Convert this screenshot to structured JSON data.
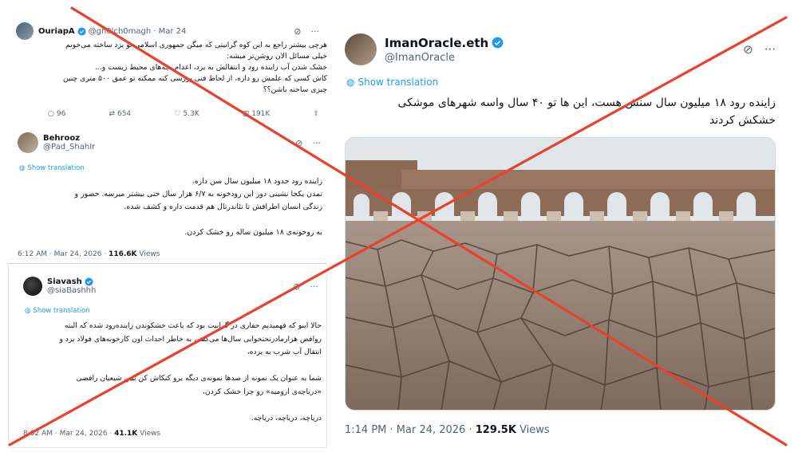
{
  "colors": {
    "accent": "#1d9bf0",
    "cross": "#e8412c",
    "text": "#0f1419",
    "muted": "#536471"
  },
  "tweet1": {
    "name": "OuriapA",
    "handle": "@gh0lch0magh",
    "date": "· Mar 24",
    "body": "هرچی بیشتر راجع به این کوه گرانیتی که میگن جمهوری اسلامی تو یزد ساخته می‌خونم\nخیلی مسائل الان روشن‌تر میشه:\nخشک شدن آب زاینده رود و انتقالش به یزد، اعدام بچه‌های محیط زیست و...\nکاش کسی که علمش رو داره، از لحاظ فنی بررسی کنه ممکنه تو عمق ۵۰۰ متری چنین\nچیزی ساخته باشن؟؟",
    "replies": "96",
    "reposts": "654",
    "likes": "5.3K",
    "views": "191K"
  },
  "tweet2": {
    "name": "Behrooz",
    "handle": "@Pad_ShahIr",
    "show_translation": "Show translation",
    "body": "زاینده رود حدود ۱۸ میلیون سال سن داره.\nتمدن یکجا نشینی دور این رودخونه به ۶/۷ هزار سال حتی بیشتر میرسه. حضور و\nزندگی انسان اطرافش تا نئاندرتال هم قدمت داره و کشف شده.\n\nبه روخونه‌ی ۱۸ میلیون ساله رو خشک کردن.",
    "time": "6:12 AM · Mar 24, 2026 · ",
    "views_count": "116.6K",
    "views_label": " Views"
  },
  "tweet3": {
    "name": "Siavash",
    "handle": "@siaBashhh",
    "show_translation": "Show translation",
    "body": "حالا اینو که فهمیدیم حفاری در گرانیت بود که باعث خشکوندن زاینده‌رود شده که البته\nروافض هزارمادرتختخوابی سال‌ها می‌گفتن به خاطر احداث اون کارخونه‌های فولاد یزد و\nانتقال آب شرب به یزده،\n\nشما به عنوان یک نمونه از صدها نمونه‌ی دیگه برو کنکاش کن ببین شیعیان رافضی\n«دریاچه‌ی ارومیه» رو چرا خشک کردن،\n\nدریاچه، دریاچه، دریاچه.",
    "time": "8:02 AM · Mar 24, 2026 · ",
    "views_count": "41.1K",
    "views_label": " Views"
  },
  "tweet_main": {
    "name": "ImanOracle.eth",
    "handle": "@ImanOracle",
    "show_translation": "Show translation",
    "body": "زاینده رود ۱۸ میلیون سال سنش هست، این ها تو ۴۰ سال واسه شهرهای موشکی\nخشکش کردند",
    "time": "1:14 PM · Mar 24, 2026 · ",
    "views_count": "129.5K",
    "views_label": " Views"
  },
  "icons": {
    "grok": "grok-icon",
    "more": "more-icon",
    "verified": "verified-badge-icon",
    "translate": "translate-icon",
    "reply": "reply-icon",
    "repost": "repost-icon",
    "like": "like-icon",
    "views": "views-icon"
  }
}
